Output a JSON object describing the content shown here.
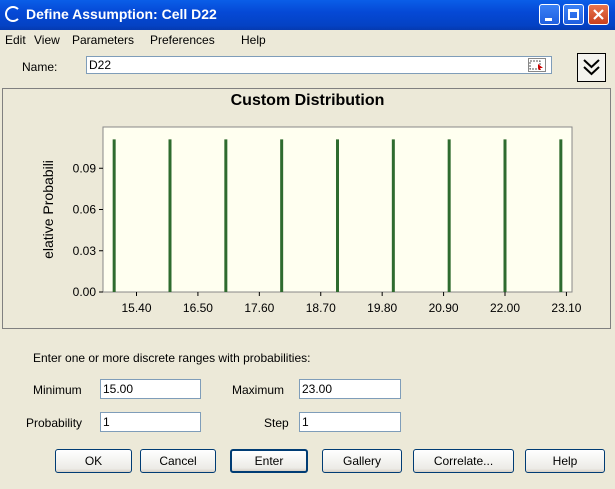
{
  "window": {
    "title": "Define Assumption: Cell D22"
  },
  "menu": [
    "Edit",
    "View",
    "Parameters",
    "Preferences",
    "Help"
  ],
  "name": {
    "label": "Name:",
    "value": "D22"
  },
  "chart_data": {
    "type": "bar",
    "title": "Custom Distribution",
    "ylabel": "elative Probabili",
    "xlabel": "",
    "x_ticks": [
      "15.40",
      "16.50",
      "17.60",
      "18.70",
      "19.80",
      "20.90",
      "22.00",
      "23.10"
    ],
    "y_ticks": [
      "0.00",
      "0.03",
      "0.06",
      "0.09"
    ],
    "categories": [
      15,
      16,
      17,
      18,
      19,
      20,
      21,
      22,
      23
    ],
    "values": [
      0.111,
      0.111,
      0.111,
      0.111,
      0.111,
      0.111,
      0.111,
      0.111,
      0.111
    ],
    "xlim": [
      14.8,
      23.2
    ],
    "ylim": [
      0,
      0.12
    ],
    "bar_color": "#2e6b2e",
    "plot_bg": "#fffff0",
    "grid": false
  },
  "ranges_prompt": "Enter one or more discrete ranges with probabilities:",
  "fields": {
    "minimum": {
      "label": "Minimum",
      "value": "15.00"
    },
    "maximum": {
      "label": "Maximum",
      "value": "23.00"
    },
    "probability": {
      "label": "Probability",
      "value": "1"
    },
    "step": {
      "label": "Step",
      "value": "1"
    }
  },
  "buttons": {
    "ok": "OK",
    "cancel": "Cancel",
    "enter": "Enter",
    "gallery": "Gallery",
    "correlate": "Correlate...",
    "help": "Help"
  }
}
